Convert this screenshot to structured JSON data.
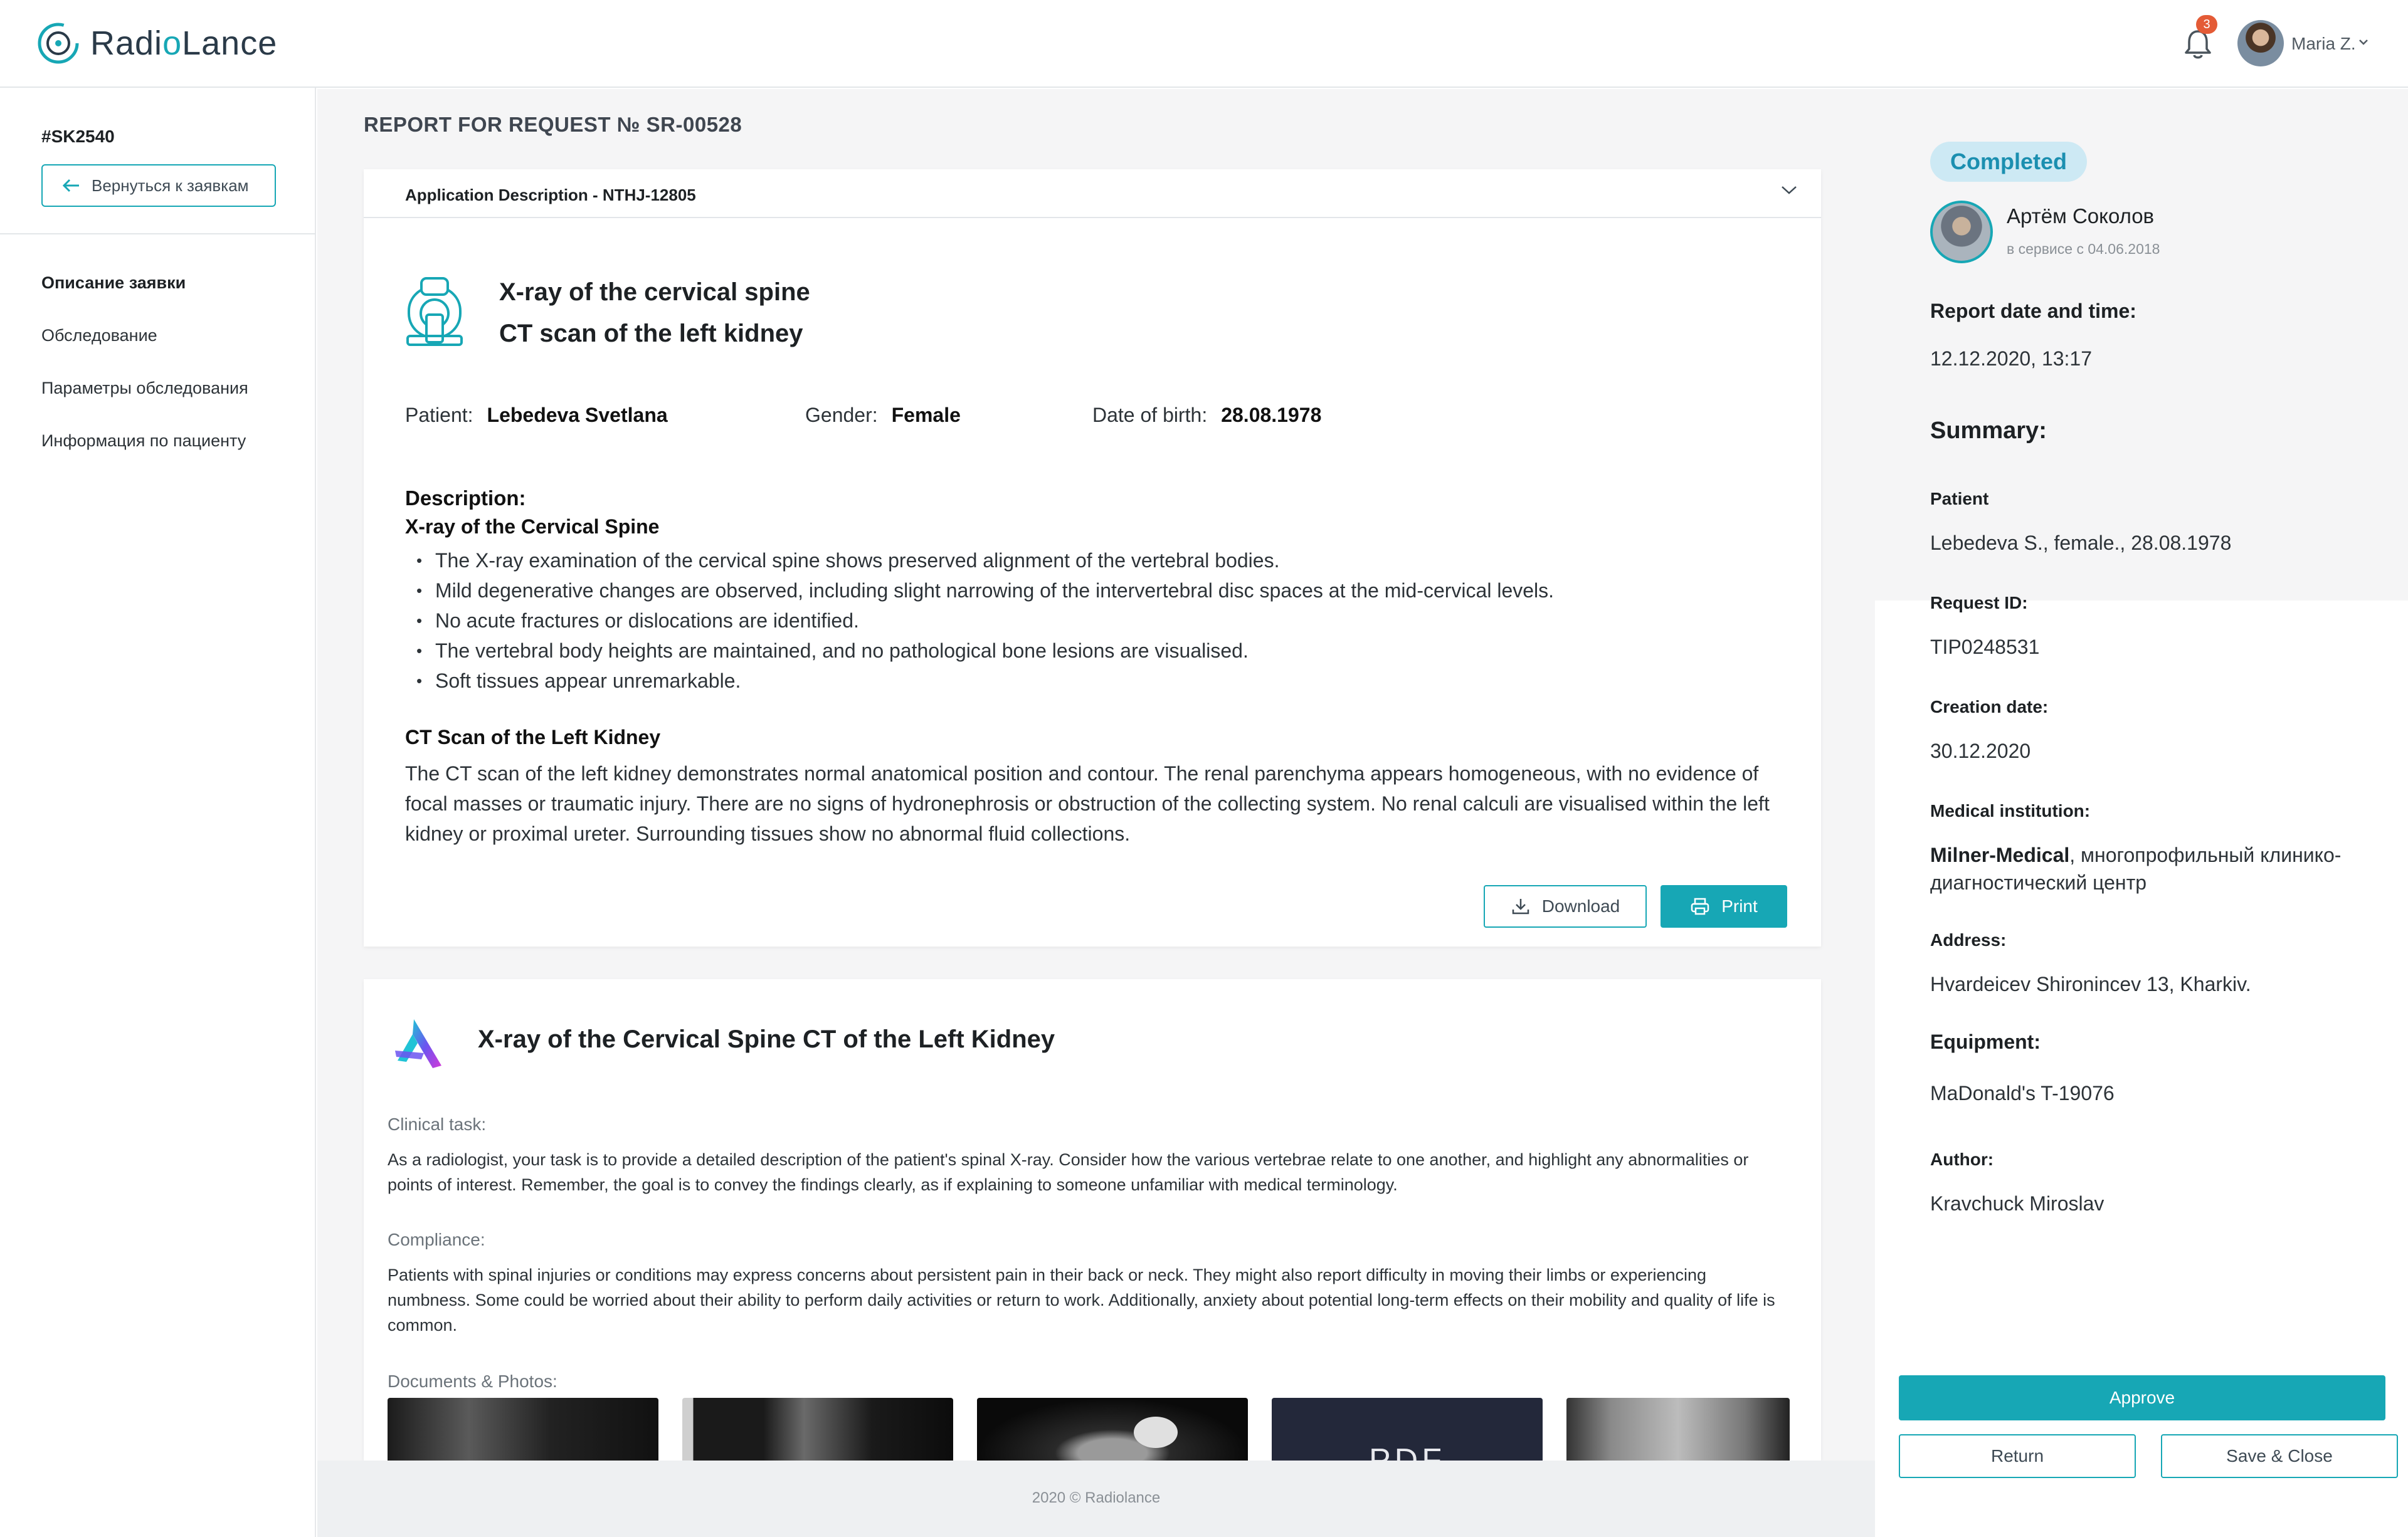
{
  "header": {
    "logo_text_a": "Radi",
    "logo_text_b": "o",
    "logo_text_c": "Lance",
    "notification_count": "3",
    "user_name": "Maria Z."
  },
  "sidebar": {
    "request_id": "#SK2540",
    "back_label": "Вернуться к заявкам",
    "items": [
      {
        "label": "Описание заявки",
        "active": true
      },
      {
        "label": "Обследование",
        "active": false
      },
      {
        "label": "Параметры обследования",
        "active": false
      },
      {
        "label": "Информация по пациенту",
        "active": false
      }
    ]
  },
  "main": {
    "report_title": "REPORT FOR REQUEST № SR-00528",
    "application": {
      "label": "Application Description - NTHJ-12805",
      "exam_title_1": "X-ray of the cervical spine",
      "exam_title_2": "CT scan of the left kidney",
      "patient_label": "Patient:",
      "patient_value": "Lebedeva Svetlana",
      "gender_label": "Gender:",
      "gender_value": "Female",
      "dob_label": "Date of birth:",
      "dob_value": "28.08.1978",
      "description_heading": "Description:",
      "xray_heading": "X-ray of the Cervical Spine",
      "xray_bullets": [
        "The X-ray examination of the cervical spine shows preserved alignment of the vertebral bodies.",
        "Mild degenerative changes are observed, including slight narrowing of the intervertebral disc spaces at the mid-cervical levels.",
        "No acute fractures or dislocations are identified.",
        "The vertebral body heights are maintained, and no pathological bone lesions are visualised.",
        "Soft tissues appear unremarkable."
      ],
      "ct_heading": "CT Scan of the Left Kidney",
      "ct_text": "The CT scan of the left kidney demonstrates normal anatomical position and contour. The renal parenchyma appears homogeneous, with no evidence of focal masses or traumatic injury. There are no signs of hydronephrosis or obstruction of the collecting system. No renal calculi are visualised within the left kidney or proximal ureter. Surrounding tissues show no abnormal fluid collections.",
      "download_label": "Download",
      "print_label": "Print"
    },
    "task_card": {
      "title": "X-ray of the Cervical Spine CT of the Left Kidney",
      "clinical_task_label": "Clinical task:",
      "clinical_task_text": "As a radiologist, your task is to provide a detailed description of the patient's spinal X-ray. Consider how the various vertebrae relate to one another, and highlight any abnormalities or points of interest. Remember, the goal is to convey the findings clearly, as if explaining to someone unfamiliar with medical terminology.",
      "compliance_label": "Compliance:",
      "compliance_text": "Patients with spinal injuries or conditions may express concerns about persistent pain in their back or neck. They might also report difficulty in moving their limbs or experiencing numbness. Some could be worried about their ability to perform daily activities or return to work. Additionally, anxiety about potential long-term effects on their mobility and quality of life is common.",
      "documents_label": "Documents & Photos:",
      "pdf_thumb_text": "PDF"
    },
    "footer": "2020 © Radiolance"
  },
  "right_panel": {
    "status": "Completed",
    "doctor_name": "Артём Соколов",
    "doctor_since": "в сервисе с 04.06.2018",
    "report_datetime_label": "Report date and time:",
    "report_datetime_value": "12.12.2020, 13:17",
    "summary_label": "Summary:",
    "patient_label": "Patient",
    "patient_value": "Lebedeva S., female.,  28.08.1978",
    "request_id_label": "Request ID:",
    "request_id_value": "TIP0248531",
    "creation_date_label": "Creation date:",
    "creation_date_value": "30.12.2020",
    "institution_label": "Medical institution:",
    "institution_name": "Milner-Medical",
    "institution_rest": ", многопрофильный клинико-диагностический центр",
    "address_label": "Address:",
    "address_value": "Hvardeicev Shironincev 13, Kharkiv.",
    "equipment_label": "Equipment:",
    "equipment_value": "MaDonald's T-19076",
    "author_label": "Author:",
    "author_value": "Kravchuck Miroslav",
    "approve_label": "Approve",
    "return_label": "Return",
    "save_close_label": "Save & Close"
  },
  "colors": {
    "accent": "#17a7b5",
    "status_bg": "#cde9f4",
    "status_text": "#1b8fb0",
    "badge": "#e45b36"
  }
}
